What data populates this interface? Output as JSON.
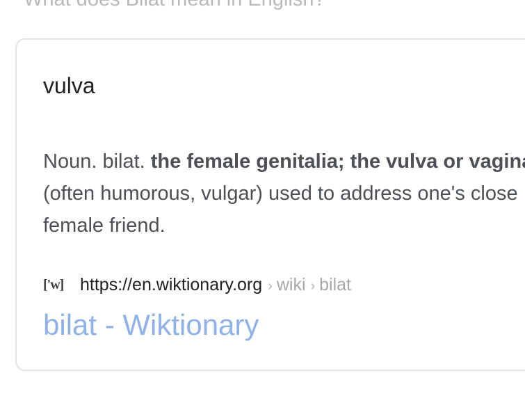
{
  "question": "What does Bilat mean in English?",
  "card": {
    "answer": "vulva",
    "definition": {
      "prefix": "Noun. bilat. ",
      "bold_part": "the female genitalia; the vulva or vagina",
      "suffix": ". (often humorous, vulgar) used to address one's close female friend."
    },
    "source": {
      "icon_text": "['w]",
      "url": "https://en.wiktionary.org",
      "crumb_1": "wiki",
      "crumb_2": "bilat",
      "separator": "›"
    },
    "result_title": "bilat - Wiktionary"
  },
  "colors": {
    "link": "#8fb1ea",
    "body_text": "#4d5156",
    "muted": "#a8a8a8",
    "border": "#e3e3e3"
  },
  "icons": {
    "source": "wiktionary-favicon-icon"
  }
}
